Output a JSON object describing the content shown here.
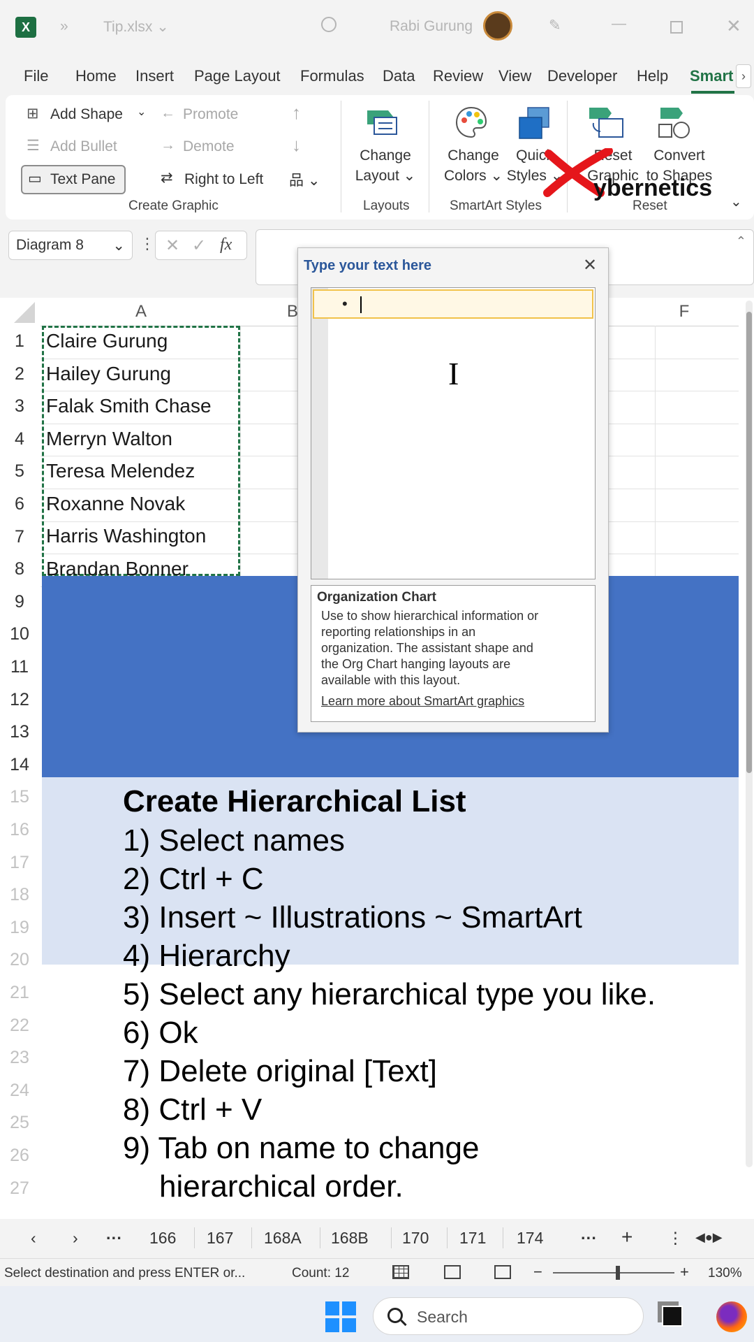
{
  "titlebar": {
    "file_name": "Tip.xlsx",
    "user": "Rabi Gurung"
  },
  "menu": [
    "File",
    "Home",
    "Insert",
    "Page Layout",
    "Formulas",
    "Data",
    "Review",
    "View",
    "Developer",
    "Help",
    "Smart"
  ],
  "ribbon": {
    "add_shape": "Add Shape",
    "add_bullet": "Add Bullet",
    "text_pane": "Text Pane",
    "promote": "Promote",
    "demote": "Demote",
    "right_to_left": "Right to Left",
    "group_create_graphic": "Create Graphic",
    "change_layout_1": "Change",
    "change_layout_2": "Layout",
    "group_layouts": "Layouts",
    "change_colors_1": "Change",
    "change_colors_2": "Colors",
    "quick_styles_1": "Quick",
    "quick_styles_2": "Styles",
    "group_smartart_styles": "SmartArt Styles",
    "reset_graphic_1": "Reset",
    "reset_graphic_2": "Graphic",
    "convert_1": "Convert",
    "convert_2": "to Shapes",
    "group_reset": "Reset",
    "watermark": "ybernetics"
  },
  "formula_bar": {
    "name_box": "Diagram 8",
    "fx": "fx"
  },
  "columns": [
    "A",
    "B",
    "F"
  ],
  "rows": [
    "1",
    "2",
    "3",
    "4",
    "5",
    "6",
    "7",
    "8",
    "9",
    "10",
    "11",
    "12",
    "13",
    "14",
    "15",
    "16",
    "17",
    "18",
    "19",
    "20",
    "21",
    "22",
    "23",
    "24",
    "25",
    "26",
    "27"
  ],
  "names": [
    "Claire Gurung",
    "Hailey Gurung",
    "Falak Smith Chase",
    "Merryn Walton",
    "Teresa Melendez",
    "Roxanne Novak",
    "Harris Washington",
    "Brandan Bonner"
  ],
  "text_pane": {
    "title": "Type your text here",
    "desc_title": "Organization Chart",
    "desc_body_1": "Use to show hierarchical information or",
    "desc_body_2": "reporting relationships in an",
    "desc_body_3": "organization. The assistant shape and",
    "desc_body_4": "the Org Chart hanging layouts are",
    "desc_body_5": "available with this layout.",
    "link": "Learn more about SmartArt graphics"
  },
  "instructions": {
    "title": "Create Hierarchical List",
    "steps": [
      "1) Select names",
      "2) Ctrl + C",
      "3) Insert ~ Illustrations ~ SmartArt",
      "4) Hierarchy",
      "5) Select any hierarchical type you like.",
      "6) Ok",
      "7) Delete original [Text]",
      "8) Ctrl + V",
      "9) Tab on name to change",
      "hierarchical order."
    ]
  },
  "sheets": [
    "166",
    "167",
    "168A",
    "168B",
    "170",
    "171",
    "174"
  ],
  "status": {
    "message": "Select destination and press ENTER or...",
    "count": "Count: 12",
    "zoom": "130%"
  },
  "taskbar": {
    "search": "Search"
  }
}
